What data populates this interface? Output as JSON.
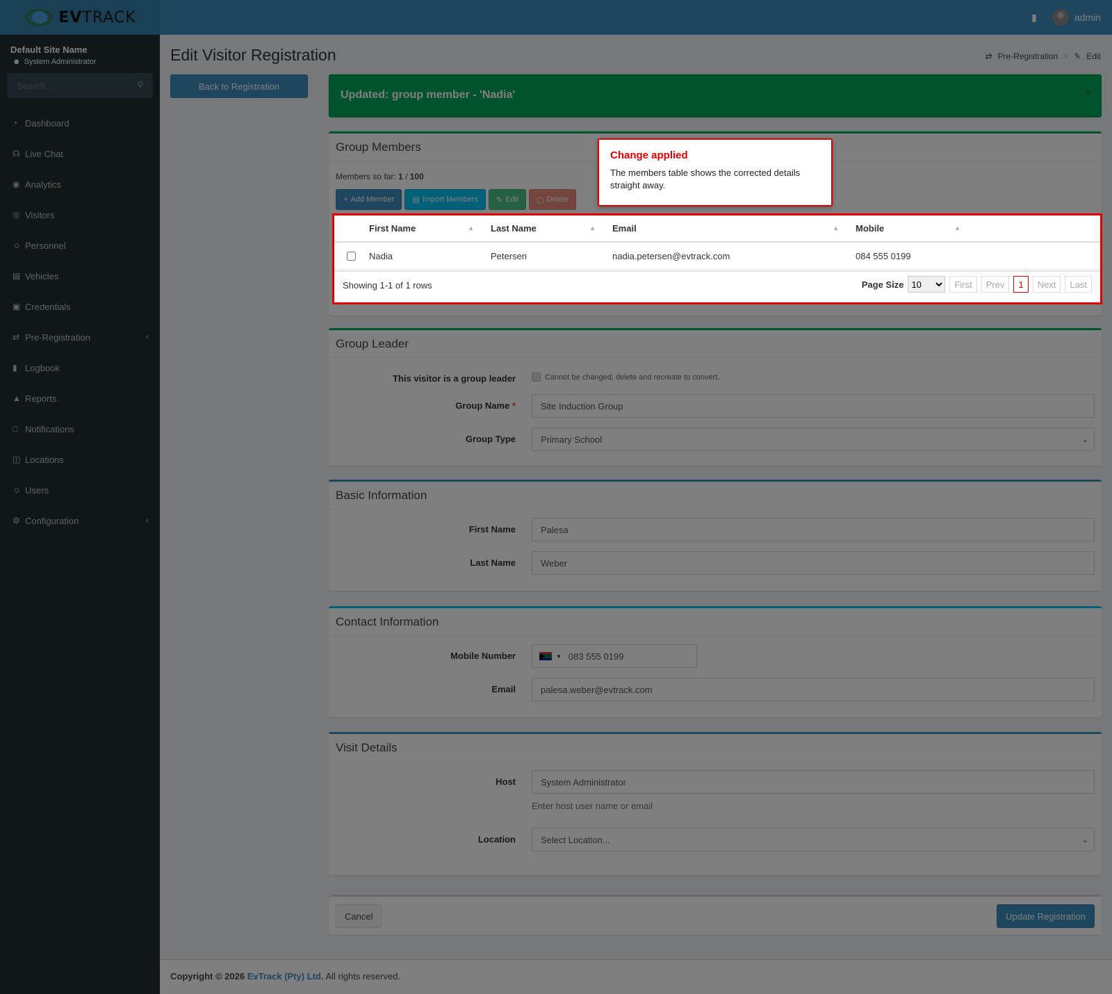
{
  "header": {
    "logo_ev": "EV",
    "logo_track": "TRACK",
    "nav_icon": "book-icon",
    "user_name": "admin"
  },
  "sidebar": {
    "site_name": "Default Site Name",
    "role": "System Administrator",
    "search_placeholder": "Search...",
    "items": [
      {
        "label": "Dashboard",
        "icon": "dashboard-icon"
      },
      {
        "label": "Live Chat",
        "icon": "headset-icon"
      },
      {
        "label": "Analytics",
        "icon": "target-icon"
      },
      {
        "label": "Visitors",
        "icon": "eye-icon"
      },
      {
        "label": "Personnel",
        "icon": "personnel-icon"
      },
      {
        "label": "Vehicles",
        "icon": "car-icon"
      },
      {
        "label": "Credentials",
        "icon": "badge-icon"
      },
      {
        "label": "Pre-Registration",
        "icon": "exchange-icon",
        "has_children": true
      },
      {
        "label": "Logbook",
        "icon": "book-icon"
      },
      {
        "label": "Reports",
        "icon": "chart-icon"
      },
      {
        "label": "Notifications",
        "icon": "chat-icon"
      },
      {
        "label": "Locations",
        "icon": "map-icon"
      },
      {
        "label": "Users",
        "icon": "users-icon"
      },
      {
        "label": "Configuration",
        "icon": "gear-icon",
        "has_children": true
      }
    ]
  },
  "page": {
    "title": "Edit Visitor Registration",
    "breadcrumb": [
      "Pre-Registration",
      "Edit"
    ],
    "back_button": "Back to Registration"
  },
  "alert": {
    "message": "Updated: group member - 'Nadia'",
    "close": "×"
  },
  "callout": {
    "title": "Change applied",
    "body": "The members table shows the corrected details straight away."
  },
  "group_members": {
    "title": "Group Members",
    "count_label": "Members so far:",
    "count_current": "1",
    "count_max": "100",
    "toolbar": {
      "add": "Add Member",
      "import": "Import Members",
      "edit": "Edit",
      "delete": "Delete"
    },
    "columns": [
      "First Name",
      "Last Name",
      "Email",
      "Mobile"
    ],
    "rows": [
      {
        "first": "Nadia",
        "last": "Petersen",
        "email": "nadia.petersen@evtrack.com",
        "mobile": "084 555 0199"
      }
    ],
    "showing": "Showing 1-1 of 1 rows",
    "page_size_label": "Page Size",
    "page_size": "10",
    "pager": {
      "first": "First",
      "prev": "Prev",
      "current": "1",
      "next": "Next",
      "last": "Last"
    }
  },
  "group_leader": {
    "title": "Group Leader",
    "leader_label": "This visitor is a group leader",
    "leader_note": "Cannot be changed; delete and recreate to convert.",
    "group_name_label": "Group Name",
    "group_name_req": "*",
    "group_name": "Site Induction Group",
    "group_type_label": "Group Type",
    "group_type": "Primary School"
  },
  "basic_info": {
    "title": "Basic Information",
    "first_name_label": "First Name",
    "first_name": "Palesa",
    "last_name_label": "Last Name",
    "last_name": "Weber"
  },
  "contact_info": {
    "title": "Contact Information",
    "mobile_label": "Mobile Number",
    "mobile": "083 555 0199",
    "email_label": "Email",
    "email": "palesa.weber@evtrack.com"
  },
  "visit_details": {
    "title": "Visit Details",
    "host_label": "Host",
    "host": "System Administrator",
    "host_help": "Enter host user name or email",
    "location_label": "Location",
    "location": "Select Location..."
  },
  "actions": {
    "cancel": "Cancel",
    "update": "Update Registration"
  },
  "footer": {
    "copyright": "Copyright © 2026",
    "company": "EvTrack (Pty) Ltd.",
    "rights": "All rights reserved."
  },
  "colors": {
    "header": "#3c8dbc",
    "sidebar": "#222d32",
    "success": "#00a65a",
    "highlight": "#e00000"
  }
}
